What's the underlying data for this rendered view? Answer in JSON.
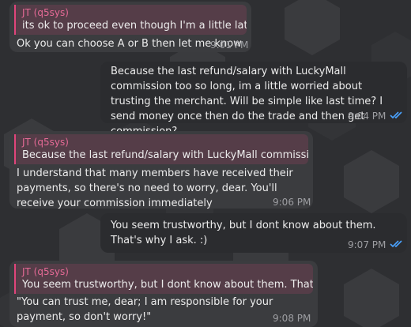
{
  "colors": {
    "background": "#2e2f32",
    "incoming_bubble": "#3b3c3f",
    "outgoing_bubble": "#2b2c2f",
    "reply_accent": "#e0457b",
    "read_ticks": "#4aa3ff"
  },
  "messages": [
    {
      "direction": "incoming",
      "reply": {
        "name": "JT (q5sys)",
        "text": "its ok to proceed even though I'm a little late sin..."
      },
      "text": "Ok you can choose A or B then let me know",
      "time": "9:01 PM"
    },
    {
      "direction": "outgoing",
      "text": "Because the last refund/salary with LuckyMall commission too so long, im a little worried about trusting the merchant.  Will be simple like last time?  I send money once then do the trade and then get commission?",
      "time": "9:04 PM",
      "status_icon": "double-check-icon"
    },
    {
      "direction": "incoming",
      "reply": {
        "name": "JT (q5sys)",
        "text": "Because the last refund/salary with LuckyMall commission too ..."
      },
      "text": "I understand that many members have received their payments, so there's no need to worry, dear. You'll receive your commission immediately",
      "time": "9:06 PM"
    },
    {
      "direction": "outgoing",
      "text": "You seem trustworthy, but I dont know about them.  That's why I ask. :)",
      "time": "9:07 PM",
      "status_icon": "double-check-icon"
    },
    {
      "direction": "incoming",
      "reply": {
        "name": "JT (q5sys)",
        "text": "You seem trustworthy, but I dont know about them.  That's wh..."
      },
      "text": "\"You can trust me, dear; I am responsible for your payment, so don't worry!\"",
      "time": "9:08 PM"
    }
  ]
}
